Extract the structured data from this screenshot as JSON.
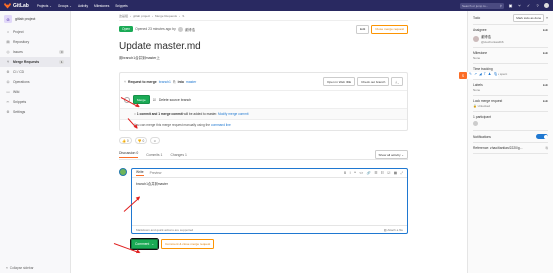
{
  "topnav": {
    "brand": "GitLab",
    "menu": [
      "Projects ⌄",
      "Groups ⌄",
      "Activity",
      "Milestones",
      "Snippets"
    ],
    "search_placeholder": "Search or jump to..."
  },
  "sidebar": {
    "project_initial": "G",
    "project_name": "gitlab project",
    "items": [
      {
        "label": "Project",
        "icon": "home-icon"
      },
      {
        "label": "Repository",
        "icon": "doc-icon"
      },
      {
        "label": "Issues",
        "icon": "issues-icon",
        "count": "0"
      },
      {
        "label": "Merge Requests",
        "icon": "merge-icon",
        "count": "1",
        "active": true
      },
      {
        "label": "CI / CD",
        "icon": "rocket-icon"
      },
      {
        "label": "Operations",
        "icon": "ops-icon"
      },
      {
        "label": "Wiki",
        "icon": "book-icon"
      },
      {
        "label": "Snippets",
        "icon": "snippet-icon"
      },
      {
        "label": "Settings",
        "icon": "gear-icon"
      }
    ],
    "collapse_label": "Collapse sidebar"
  },
  "breadcrumb": [
    "这是组",
    "gitlab project",
    "Merge Requests",
    "!1"
  ],
  "status": {
    "badge": "Open",
    "text": "Opened 23 minutes ago by",
    "author": "谢博浩",
    "edit_label": "Edit",
    "close_label": "Close merge request"
  },
  "mr": {
    "title": "Update master.md",
    "description": "用branch1合并到master上",
    "request_text": "Request to merge",
    "source_branch": "branch1",
    "into_text": "into",
    "target_branch": "master",
    "open_webide": "Open in Web IDE",
    "checkout": "Check out branch",
    "download": "⤓ ⌄",
    "merge_button": "Merge",
    "delete_source": "Delete source branch",
    "commit_info_a": "1 commit and 1 merge commit",
    "commit_info_b": "will be added to master.",
    "commit_info_link": "Modify merge commit",
    "info_text": "You can merge this merge request manually using the",
    "info_link": "command line",
    "thumbs_up": "👍 0",
    "thumbs_down": "👎 0",
    "emoji": "☺"
  },
  "tabs": {
    "discussion": "Discussion 0",
    "commits": "Commits 1",
    "changes": "Changes 1",
    "show_all": "Show all activity ⌄"
  },
  "editor": {
    "write": "Write",
    "preview": "Preview",
    "tools": [
      "B",
      "I",
      "❝",
      "<>",
      "🔗",
      "☰",
      "☷",
      "☑",
      "▦",
      "⤢"
    ],
    "text": "branch1合并到master",
    "footer": "Markdown and quick actions are supported",
    "attach": "Attach a file",
    "comment_label": "Comment",
    "close_label": "Comment & close merge request"
  },
  "right_sidebar": {
    "todo": "Todo",
    "mark_done": "Mark todo as done",
    "assignee_label": "Assignee",
    "edit": "Edit",
    "assignee_name": "谢博浩",
    "assignee_handle": "@xiechuntao2b6",
    "milestone_label": "Milestone",
    "milestone_value": "None",
    "time_label": "Time tracking",
    "time_value": "No estimate or time spent",
    "labels_label": "Labels",
    "labels_value": "None",
    "lock_label": "Lock merge request",
    "lock_value": "Unlocked",
    "participants": "1 participant",
    "notifications": "Notifications",
    "reference": "Reference: zhao/tiantian/2220/g..."
  }
}
